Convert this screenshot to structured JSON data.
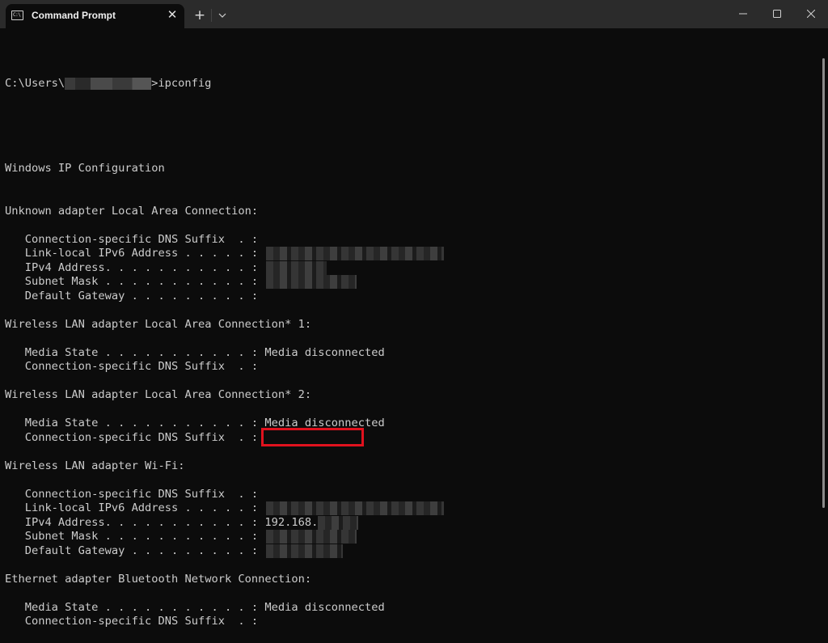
{
  "window": {
    "tab_title": "Command Prompt",
    "tab_icon": "cmd-icon",
    "tab_icon_text": "C:\\",
    "new_tab_label": "+",
    "close_tab_label": "✕"
  },
  "colors": {
    "terminal_bg": "#0c0c0c",
    "terminal_text": "#cccccc",
    "titlebar_bg": "#2b2b2b",
    "highlight_border": "#e0121e"
  },
  "terminal": {
    "prompt_prefix": "C:\\Users\\",
    "prompt_suffix": ">ipconfig",
    "lines": [
      {
        "text": "Windows IP Configuration"
      },
      {
        "text": ""
      },
      {
        "text": ""
      },
      {
        "text": "Unknown adapter Local Area Connection:"
      },
      {
        "text": ""
      },
      {
        "text": "   Connection-specific DNS Suffix  . :"
      },
      {
        "text": "   Link-local IPv6 Address . . . . . :",
        "redacted": true
      },
      {
        "text": "   IPv4 Address. . . . . . . . . . . :",
        "redacted": true
      },
      {
        "text": "   Subnet Mask . . . . . . . . . . . :",
        "redacted": true
      },
      {
        "text": "   Default Gateway . . . . . . . . . :"
      },
      {
        "text": ""
      },
      {
        "text": "Wireless LAN adapter Local Area Connection* 1:"
      },
      {
        "text": ""
      },
      {
        "text": "   Media State . . . . . . . . . . . : Media disconnected"
      },
      {
        "text": "   Connection-specific DNS Suffix  . :"
      },
      {
        "text": ""
      },
      {
        "text": "Wireless LAN adapter Local Area Connection* 2:"
      },
      {
        "text": ""
      },
      {
        "text": "   Media State . . . . . . . . . . . : Media disconnected"
      },
      {
        "text": "   Connection-specific DNS Suffix  . :"
      },
      {
        "text": ""
      },
      {
        "text": "Wireless LAN adapter Wi-Fi:"
      },
      {
        "text": ""
      },
      {
        "text": "   Connection-specific DNS Suffix  . :"
      },
      {
        "text": "   Link-local IPv6 Address . . . . . :",
        "redacted": true
      },
      {
        "text": "   IPv4 Address. . . . . . . . . . . : 192.168.",
        "redacted": true,
        "highlighted": true
      },
      {
        "text": "   Subnet Mask . . . . . . . . . . . :",
        "redacted": true
      },
      {
        "text": "   Default Gateway . . . . . . . . . :",
        "redacted": true
      },
      {
        "text": ""
      },
      {
        "text": "Ethernet adapter Bluetooth Network Connection:"
      },
      {
        "text": ""
      },
      {
        "text": "   Media State . . . . . . . . . . . : Media disconnected"
      },
      {
        "text": "   Connection-specific DNS Suffix  . :"
      }
    ]
  }
}
